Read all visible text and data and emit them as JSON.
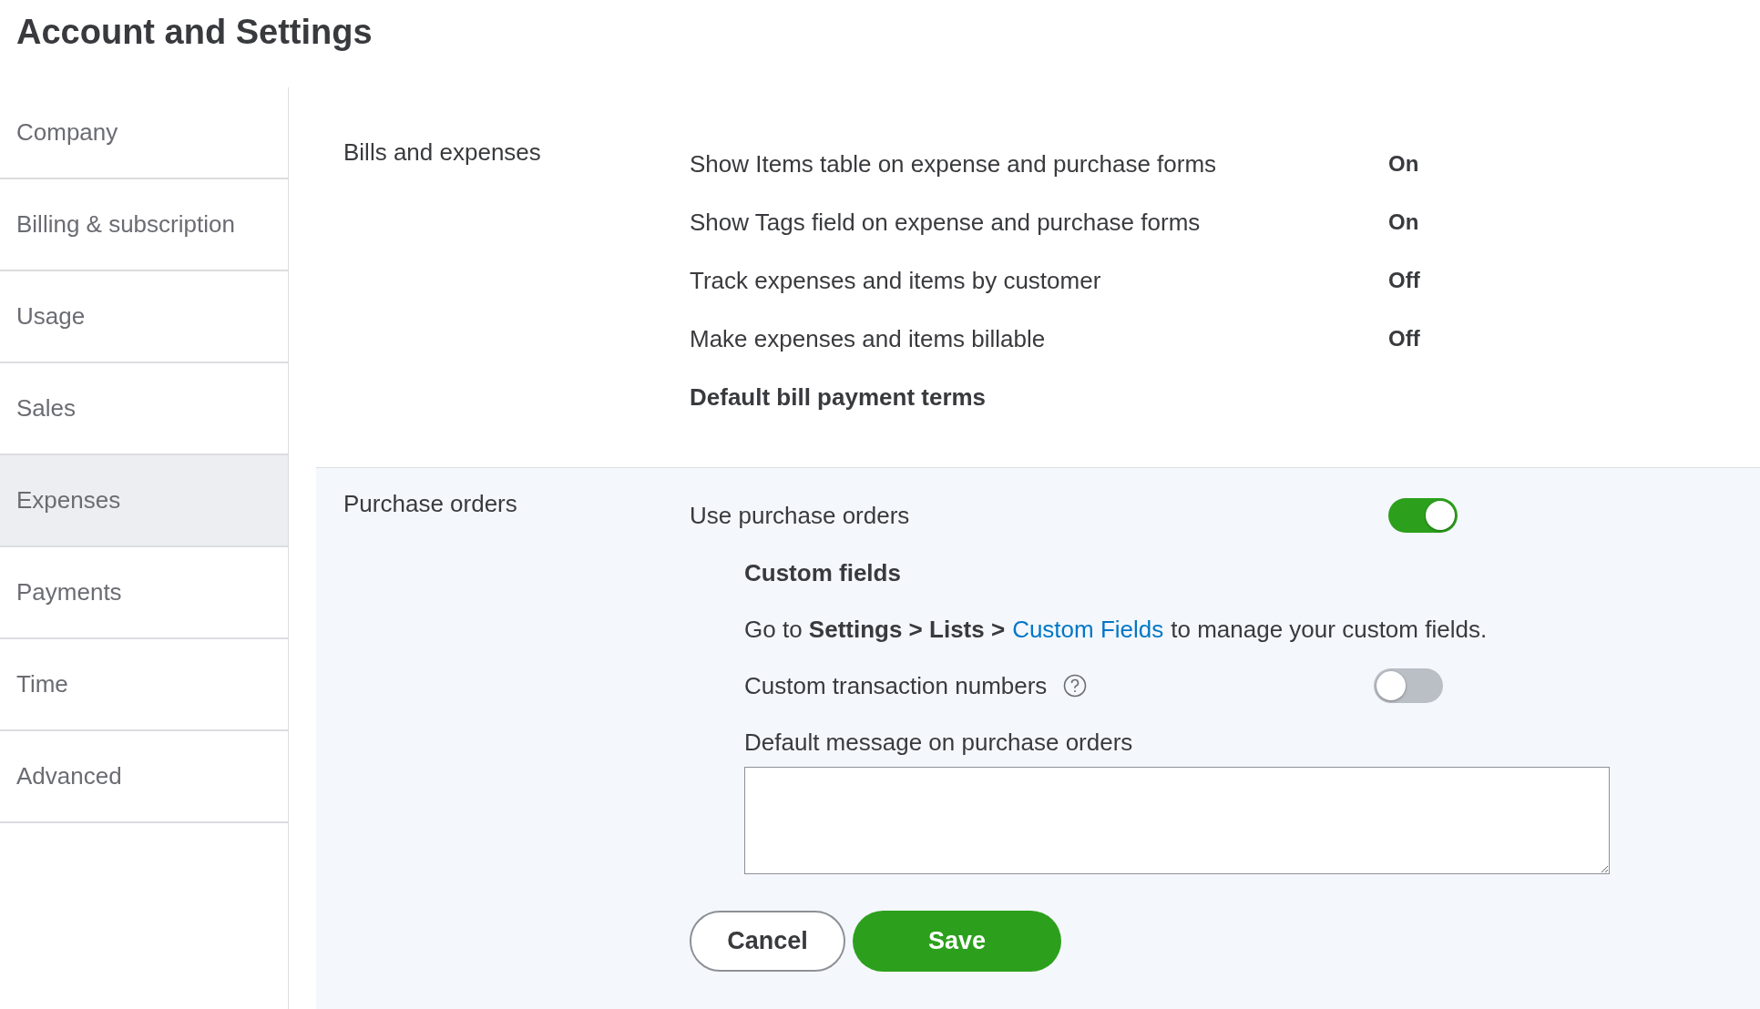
{
  "page": {
    "title": "Account and Settings"
  },
  "sidebar": {
    "items": [
      {
        "label": "Company",
        "selected": false
      },
      {
        "label": "Billing & subscription",
        "selected": false
      },
      {
        "label": "Usage",
        "selected": false
      },
      {
        "label": "Sales",
        "selected": false
      },
      {
        "label": "Expenses",
        "selected": true
      },
      {
        "label": "Payments",
        "selected": false
      },
      {
        "label": "Time",
        "selected": false
      },
      {
        "label": "Advanced",
        "selected": false
      }
    ]
  },
  "bills_section": {
    "title": "Bills and expenses",
    "rows": [
      {
        "kind": "value",
        "label": "Show Items table on expense and purchase forms",
        "value": "On"
      },
      {
        "kind": "value",
        "label": "Show Tags field on expense and purchase forms",
        "value": "On"
      },
      {
        "kind": "value",
        "label": "Track expenses and items by customer",
        "value": "Off"
      },
      {
        "kind": "value",
        "label": "Make expenses and items billable",
        "value": "Off"
      },
      {
        "kind": "heading",
        "label": "Default bill payment terms"
      }
    ]
  },
  "purchase_section": {
    "title": "Purchase orders",
    "use_purchase_orders": {
      "label": "Use purchase orders",
      "on": true
    },
    "custom_fields": {
      "heading": "Custom fields",
      "note": "Go to **Settings > Lists >**",
      "link": "Custom Fields",
      "note_end": "to manage your custom fields."
    },
    "custom_transaction_numbers": {
      "label": "Custom transaction numbers",
      "on": false
    },
    "default_message": {
      "label": "Default message on purchase orders"
    },
    "buttons": {
      "cancel": "Cancel",
      "save": "Save"
    }
  }
}
